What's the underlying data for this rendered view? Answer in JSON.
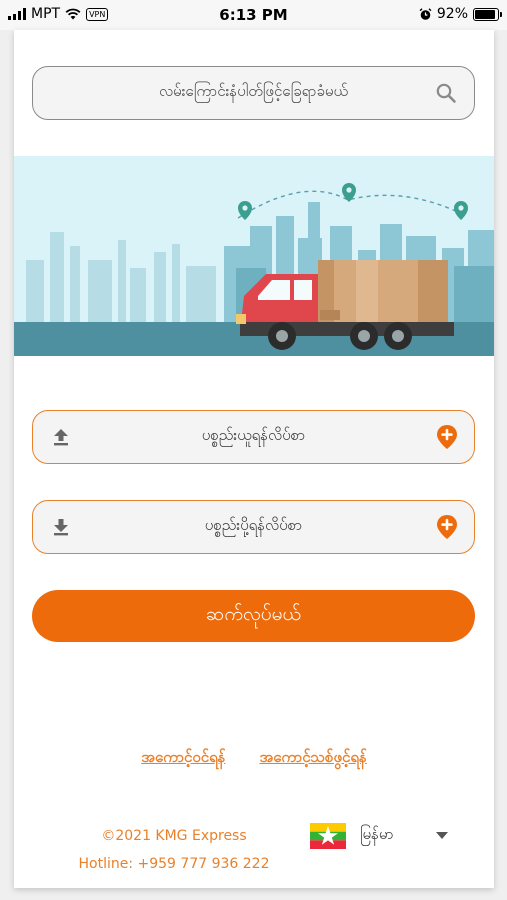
{
  "status_bar": {
    "carrier": "MPT",
    "vpn": "VPN",
    "time": "6:13 PM",
    "battery": "92%",
    "battery_level": 0.92
  },
  "search": {
    "placeholder": "လမ်းကြောင်းနံပါတ်ဖြင့်ခြေရာခံမယ်",
    "icon": "search-icon"
  },
  "banner": {
    "illustration": "delivery-truck-city-illustration",
    "colors": {
      "sky": "#d9f3f8",
      "road": "#4e8fa0",
      "truck_cab": "#e0474c",
      "cargo": "#d6a97c"
    }
  },
  "pickup": {
    "label": "ပစ္စည်းယူရန်လိပ်စာ",
    "lead_icon": "upload-icon",
    "action_icon": "add-location-icon"
  },
  "dropoff": {
    "label": "ပစ္စည်းပို့ရန်လိပ်စာ",
    "lead_icon": "download-icon",
    "action_icon": "add-location-icon"
  },
  "submit": {
    "label": "ဆက်လုပ်မယ်"
  },
  "links": {
    "login": "အကောင့်ဝင်ရန်",
    "register": "အကောင့်သစ်ဖွင့်ရန်"
  },
  "footer": {
    "copyright": "©2021 KMG Express",
    "hotline": "Hotline: +959 777 936 222"
  },
  "language": {
    "selected": "မြန်မာ",
    "flag": "myanmar-flag-icon"
  },
  "colors": {
    "accent": "#ee6b0c",
    "accent_text": "#e8812a"
  }
}
